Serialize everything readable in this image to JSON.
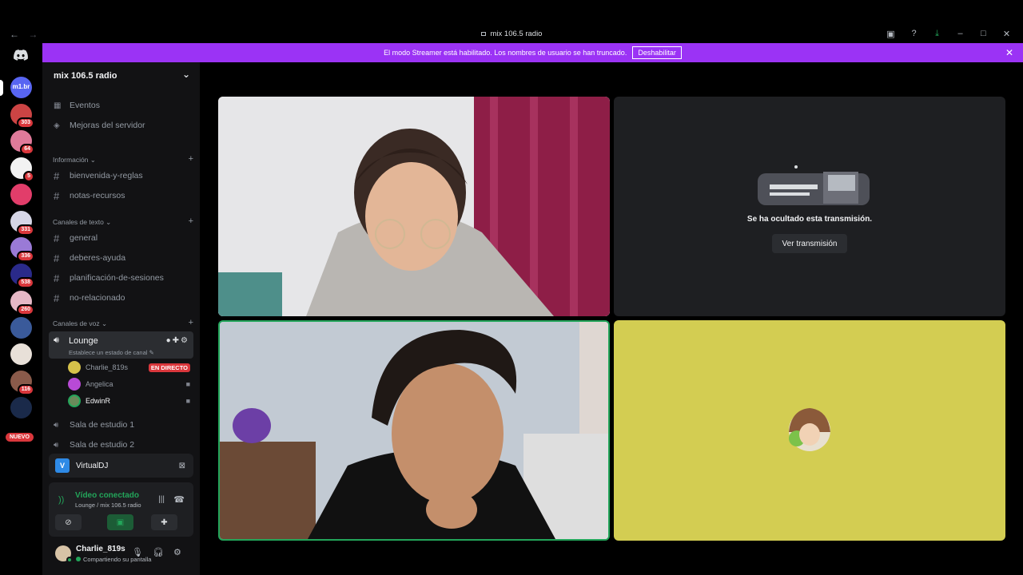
{
  "window": {
    "title": "mix 106.5 radio",
    "nav_back": "←",
    "nav_forward": "→"
  },
  "banner": {
    "message": "El modo Streamer está habilitado. Los nombres de usuario se han truncado.",
    "button_label": "Deshabilitar",
    "close": "✕"
  },
  "rail": {
    "servers": [
      {
        "label": "m1.br",
        "color": "#5865f2"
      },
      {
        "badge": "303",
        "color": "#c44"
      },
      {
        "badge": "64",
        "color": "#e07a9a"
      },
      {
        "badge": "5",
        "color": "#f2f2f2"
      },
      {
        "color": "#e23d6a"
      },
      {
        "badge": "331",
        "color": "#d6d6e6"
      },
      {
        "badge": "336",
        "color": "#9a7ad6"
      },
      {
        "badge": "538",
        "color": "#2a2a8a"
      },
      {
        "badge": "260",
        "color": "#e6b8c6"
      },
      {
        "color": "#3a5a9a"
      },
      {
        "color": "#e8e0d8"
      },
      {
        "badge": "116",
        "color": "#8a5a4a"
      },
      {
        "color": "#1a2a4a"
      }
    ],
    "nuevo": "NUEVO"
  },
  "server": {
    "name": "mix 106.5 radio",
    "top_items": [
      {
        "icon": "calendar-icon",
        "label": "Eventos"
      },
      {
        "icon": "boost-icon",
        "label": "Mejoras del servidor"
      }
    ],
    "categories": {
      "info": "Información",
      "text": "Canales de texto",
      "voice": "Canales de voz"
    },
    "info_channels": [
      "bienvenida-y-reglas",
      "notas-recursos"
    ],
    "text_channels": [
      "general",
      "deberes-ayuda",
      "planificación-de-sesiones",
      "no-relacionado"
    ],
    "voice": {
      "active_channel": "Lounge",
      "status_placeholder": "Establece un estado de canal",
      "users": [
        {
          "name": "Charlie_819s",
          "tag": "EN DIRECTO"
        },
        {
          "name": "Angelica"
        },
        {
          "name": "EdwinR"
        }
      ],
      "other_channels": [
        "Sala de estudio 1",
        "Sala de estudio 2"
      ]
    }
  },
  "app_panel": {
    "name": "VirtualDJ",
    "icon_letter": "V"
  },
  "voice_panel": {
    "status": "Vídeo conectado",
    "location": "Lounge / mix 106.5 radio"
  },
  "user": {
    "name": "Charlie_819s",
    "status": "Compartiendo su pantalla"
  },
  "stage": {
    "hidden_stream_text": "Se ha ocultado esta transmisión.",
    "watch_button": "Ver transmisión"
  }
}
